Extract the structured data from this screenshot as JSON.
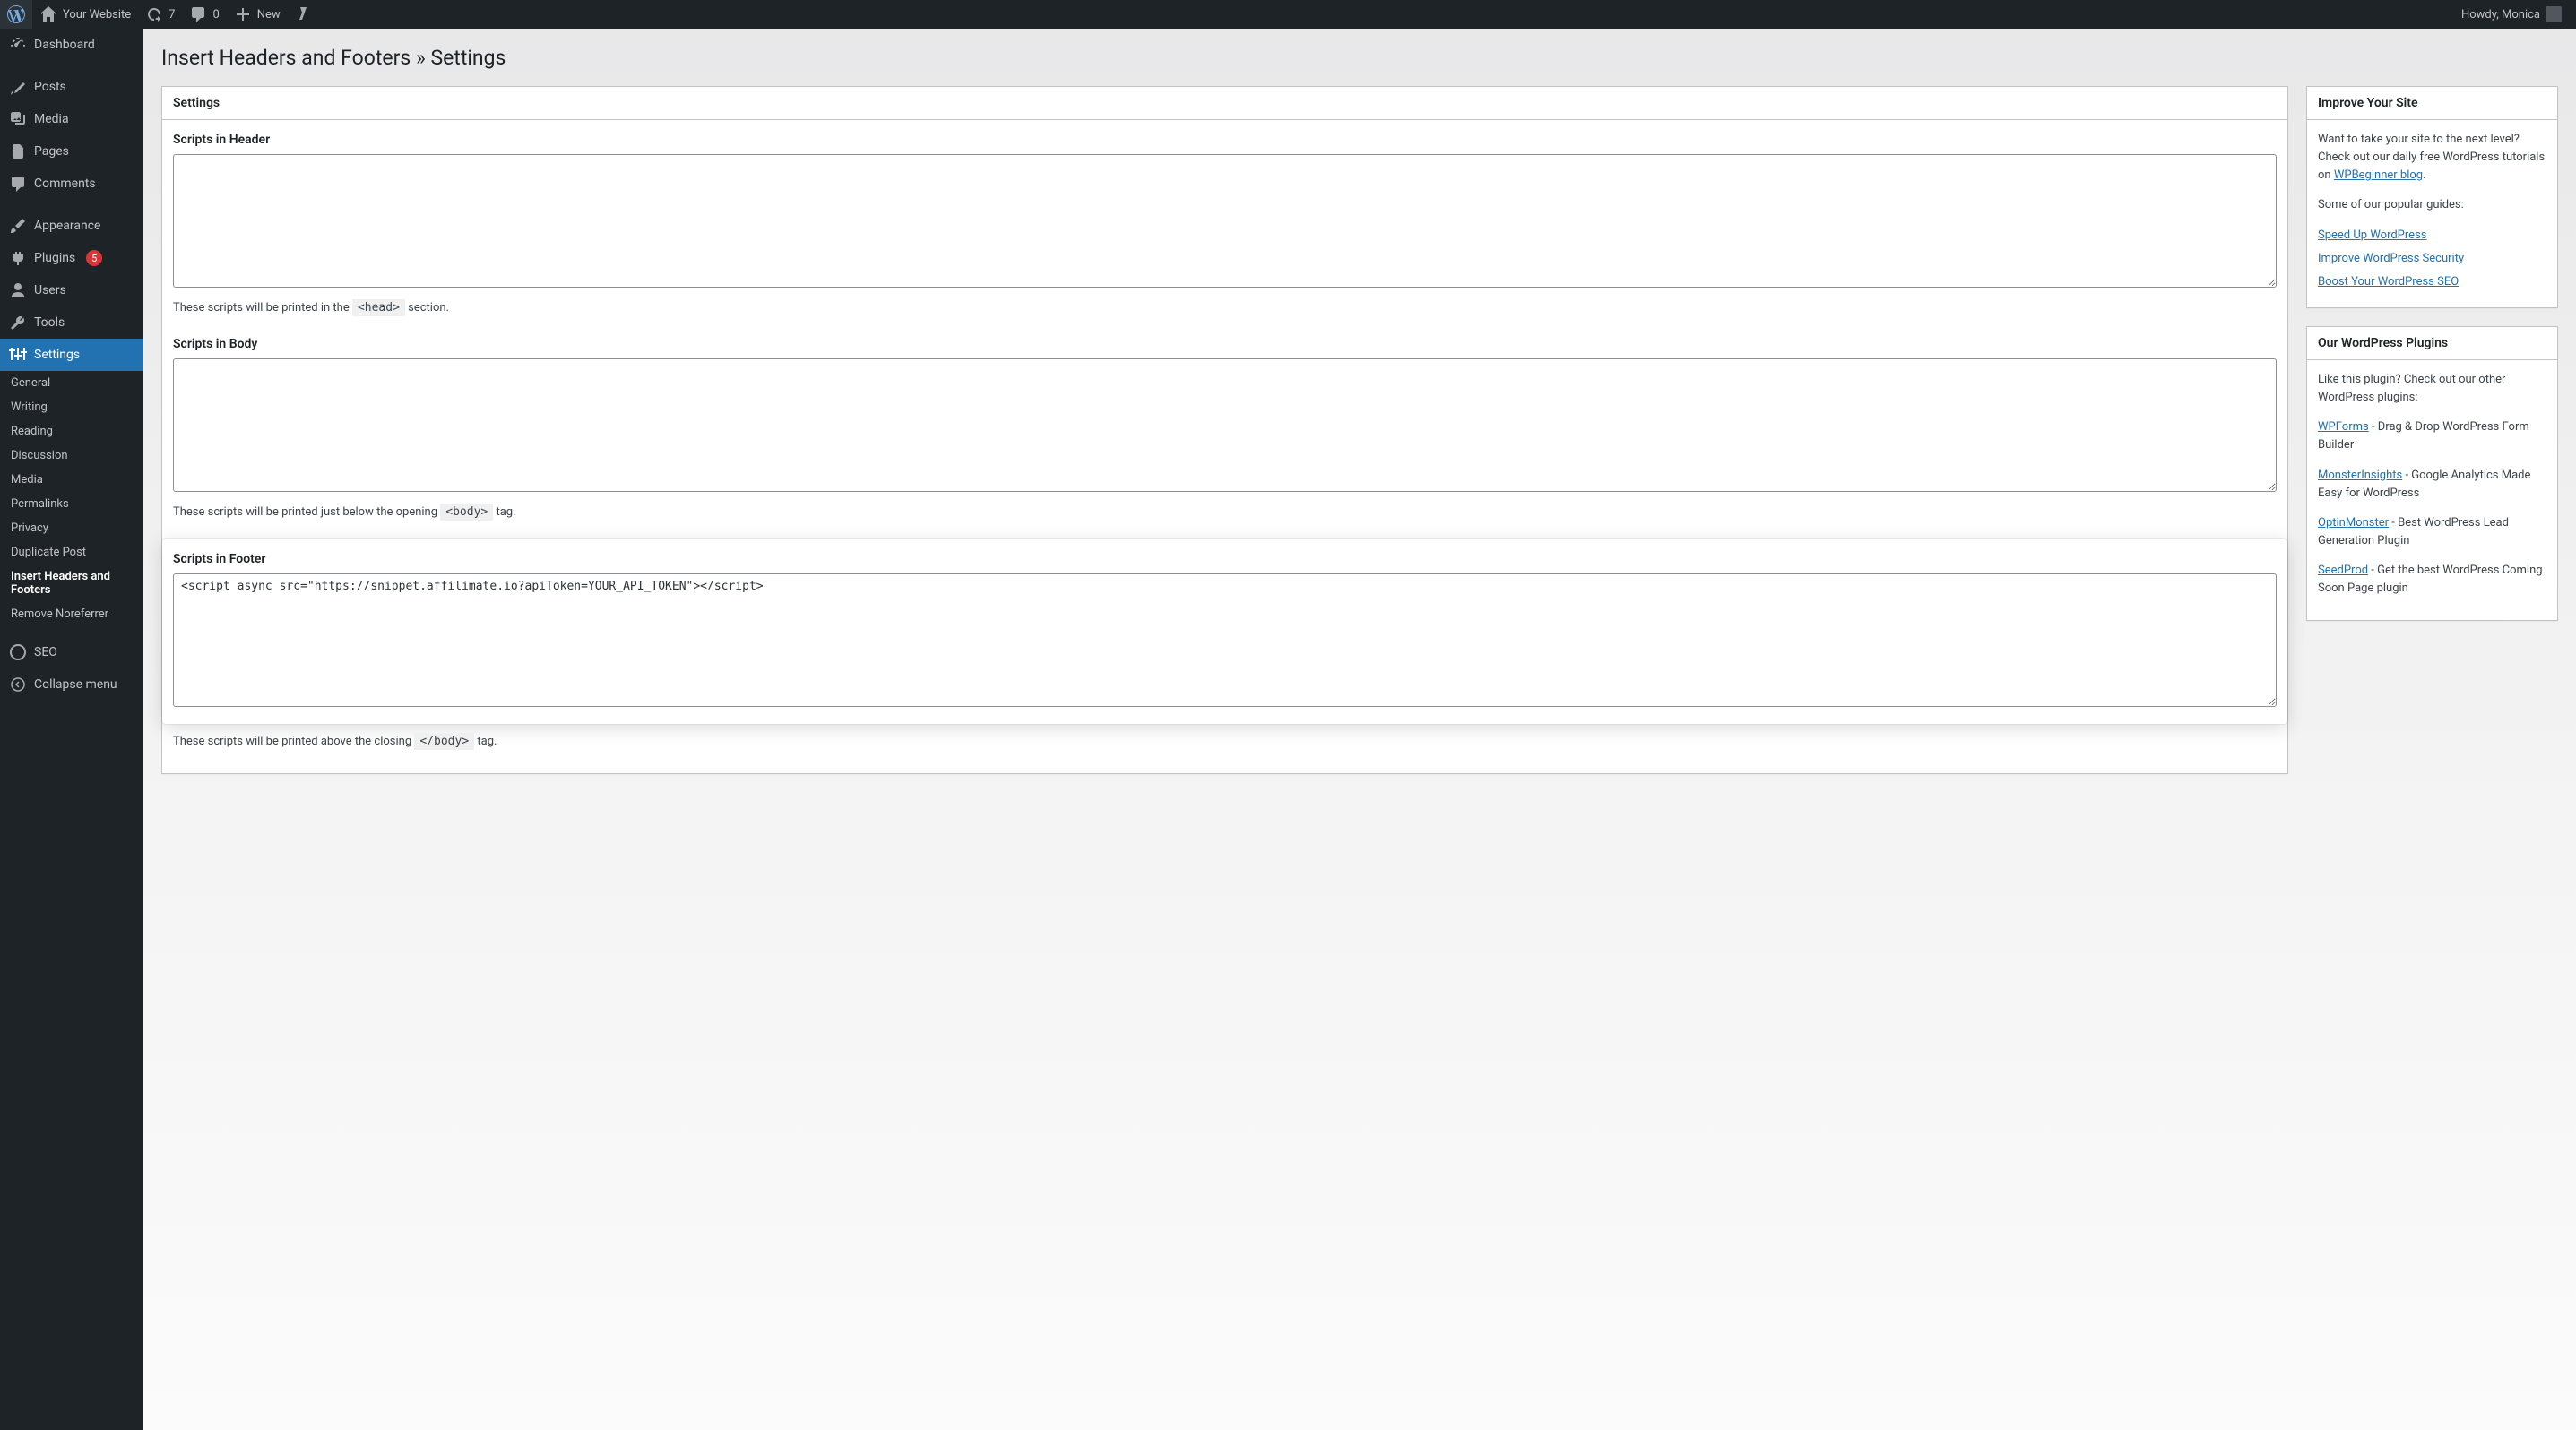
{
  "adminbar": {
    "site_name": "Your Website",
    "updates": "7",
    "comments": "0",
    "new_label": "New",
    "howdy": "Howdy, Monica"
  },
  "menu": {
    "dashboard": "Dashboard",
    "posts": "Posts",
    "media": "Media",
    "pages": "Pages",
    "comments": "Comments",
    "appearance": "Appearance",
    "plugins": "Plugins",
    "plugins_badge": "5",
    "users": "Users",
    "tools": "Tools",
    "settings": "Settings",
    "seo": "SEO",
    "collapse": "Collapse menu",
    "sub": {
      "general": "General",
      "writing": "Writing",
      "reading": "Reading",
      "discussion": "Discussion",
      "media": "Media",
      "permalinks": "Permalinks",
      "privacy": "Privacy",
      "duplicate": "Duplicate Post",
      "ihaf": "Insert Headers and Footers",
      "noreferrer": "Remove Noreferrer"
    }
  },
  "page": {
    "title": "Insert Headers and Footers » Settings",
    "settings_heading": "Settings",
    "header_label": "Scripts in Header",
    "header_value": "",
    "header_desc_pre": "These scripts will be printed in the ",
    "header_desc_code": "<head>",
    "header_desc_post": " section.",
    "body_label": "Scripts in Body",
    "body_value": "",
    "body_desc_pre": "These scripts will be printed just below the opening ",
    "body_desc_code": "<body>",
    "body_desc_post": " tag.",
    "footer_label": "Scripts in Footer",
    "footer_value": "<script async src=\"https://snippet.affilimate.io?apiToken=YOUR_API_TOKEN\"></script>",
    "footer_desc_pre": "These scripts will be printed above the closing ",
    "footer_desc_code": "</body>",
    "footer_desc_post": " tag."
  },
  "sidebar": {
    "improve_heading": "Improve Your Site",
    "improve_text_pre": "Want to take your site to the next level? Check out our daily free WordPress tutorials on ",
    "improve_link": "WPBeginner blog",
    "improve_text_post": ".",
    "guides_text": "Some of our popular guides:",
    "guides": {
      "speed": "Speed Up WordPress",
      "security": "Improve WordPress Security",
      "seo": "Boost Your WordPress SEO"
    },
    "plugins_heading": "Our WordPress Plugins",
    "plugins_text": "Like this plugin? Check out our other WordPress plugins:",
    "wpforms": "WPForms",
    "wpforms_desc": " - Drag & Drop WordPress Form Builder",
    "monster": "MonsterInsights",
    "monster_desc": " - Google Analytics Made Easy for WordPress",
    "optin": "OptinMonster",
    "optin_desc": " - Best WordPress Lead Generation Plugin",
    "seedprod": "SeedProd",
    "seedprod_desc": " - Get the best WordPress Coming Soon Page plugin"
  }
}
